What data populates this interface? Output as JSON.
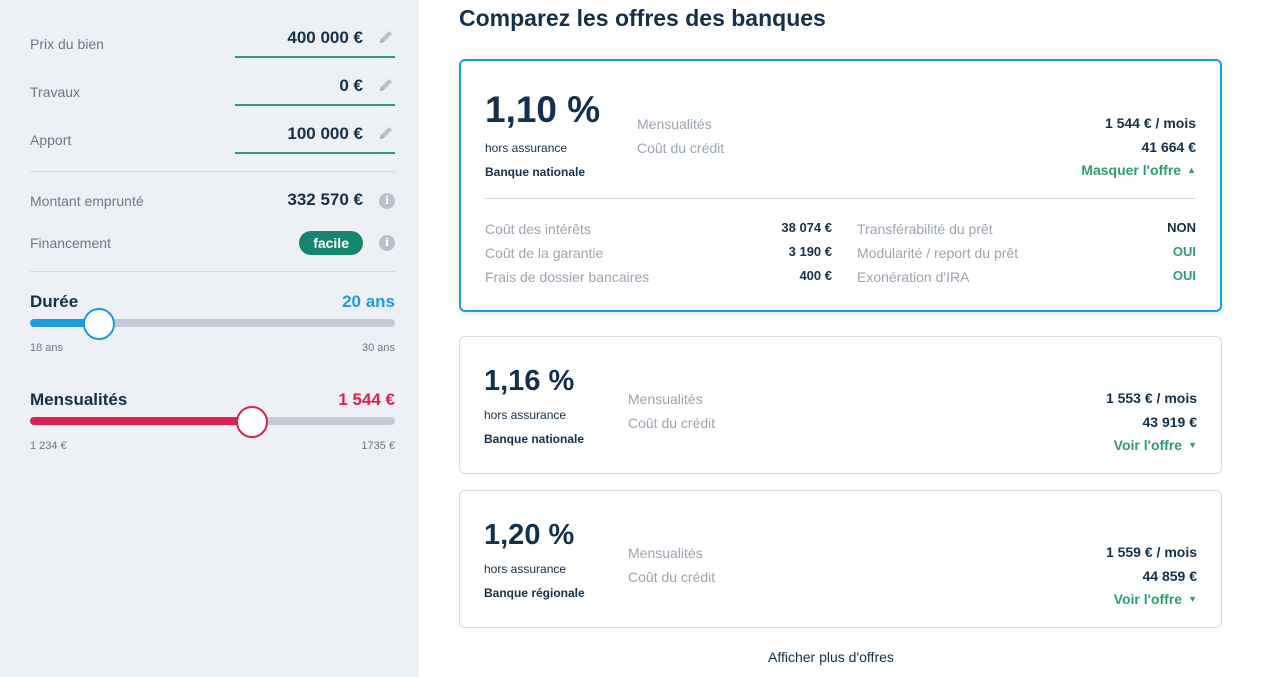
{
  "sidebar": {
    "fields": [
      {
        "label": "Prix du bien",
        "value": "400 000 €"
      },
      {
        "label": "Travaux",
        "value": "0 €"
      },
      {
        "label": "Apport",
        "value": "100 000 €"
      }
    ],
    "montant": {
      "label": "Montant emprunté",
      "value": "332 570 €",
      "info": "i"
    },
    "financement": {
      "label": "Financement",
      "badge": "facile",
      "info": "i"
    },
    "duree": {
      "title": "Durée",
      "value": "20 ans",
      "min": "18 ans",
      "max": "30 ans",
      "fraction": 0.19,
      "color": "#1d9be0"
    },
    "mensualites": {
      "title": "Mensualités",
      "value": "1 544 €",
      "min": "1 234 €",
      "max": "1735 €",
      "fraction": 0.607,
      "color": "#d8234f"
    }
  },
  "main": {
    "title": "Comparez les offres des banques",
    "offers": [
      {
        "rate": "1,10 %",
        "hors": "hors assurance",
        "bank": "Banque nationale",
        "mens_label": "Mensualités",
        "mens_value": "1 544 € / mois",
        "cout_label": "Coût du crédit",
        "cout_value": "41 664 €",
        "toggle": "Masquer l'offre",
        "details_left": [
          {
            "label": "Coût des intérêts",
            "value": "38 074 €"
          },
          {
            "label": "Coût de la garantie",
            "value": "3 190 €"
          },
          {
            "label": "Frais de dossier bancaires",
            "value": "400 €"
          }
        ],
        "details_right": [
          {
            "label": "Transférabilité du prêt",
            "value": "NON"
          },
          {
            "label": "Modularité / report du prêt",
            "value": "OUI"
          },
          {
            "label": "Exonération d'IRA",
            "value": "OUI"
          }
        ]
      },
      {
        "rate": "1,16 %",
        "hors": "hors assurance",
        "bank": "Banque nationale",
        "mens_label": "Mensualités",
        "mens_value": "1 553 € / mois",
        "cout_label": "Coût du crédit",
        "cout_value": "43 919 €",
        "toggle": "Voir l'offre"
      },
      {
        "rate": "1,20 %",
        "hors": "hors assurance",
        "bank": "Banque régionale",
        "mens_label": "Mensualités",
        "mens_value": "1 559 € / mois",
        "cout_label": "Coût du crédit",
        "cout_value": "44 859 €",
        "toggle": "Voir l'offre"
      }
    ],
    "more_link": "Afficher plus d'offres"
  },
  "colors": {
    "accent_blue": "#1d9be0",
    "accent_green": "#2e9e6e",
    "accent_red": "#d8234f",
    "badge_green": "#15856f"
  }
}
